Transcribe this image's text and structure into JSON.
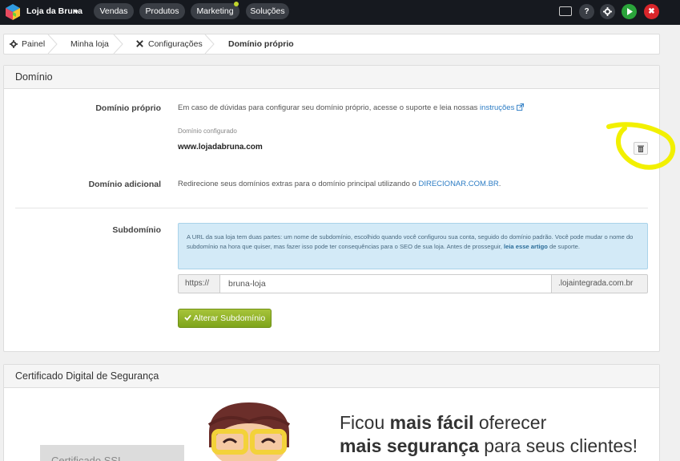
{
  "topbar": {
    "store_name": "Loja da Bruna",
    "nav": [
      "Vendas",
      "Produtos",
      "Marketing",
      "Soluções"
    ],
    "icons": [
      "monitor-icon",
      "help-icon",
      "gear-icon",
      "play-icon",
      "close-icon"
    ],
    "colors": {
      "bar": "#16191f",
      "play": "#2aa33a",
      "close": "#d9252a",
      "notification": "#c2d62d"
    }
  },
  "breadcrumb": [
    "Painel",
    "Minha loja",
    "Configurações",
    "Domínio próprio"
  ],
  "domain_panel": {
    "title": "Domínio",
    "own_domain": {
      "label": "Domínio próprio",
      "help_text": "Em caso de dúvidas para configurar seu domínio próprio, acesse o suporte e leia nossas",
      "help_link": "instruções",
      "configured_label": "Domínio configurado",
      "configured_value": "www.lojadabruna.com"
    },
    "additional_domain": {
      "label": "Domínio adicional",
      "text": "Redirecione seus domínios extras para o domínio principal utilizando o",
      "link": "DIRECIONAR.COM.BR",
      "after": "."
    },
    "subdomain": {
      "label": "Subdomínio",
      "info_line1": "A URL da sua loja tem duas partes: um nome de subdomínio, escolhido quando você configurou sua conta, seguido do domínio padrão. Você pode",
      "info_line2": "mudar o nome do subdomínio na hora que quiser, mas fazer isso pode ter consequências para o SEO de sua loja. Antes de prosseguir,",
      "info_link": "leia esse artigo",
      "info_line3": "de suporte.",
      "prefix": "https://",
      "value": "bruna-loja",
      "suffix": ".lojaintegrada.com.br",
      "button": "Alterar Subdomínio"
    }
  },
  "ssl_panel": {
    "title": "Certificado Digital de Segurança",
    "tag": "Certificado SSL",
    "promo_line1_a": "Ficou",
    "promo_line1_b": "mais fácil",
    "promo_line1_c": "oferecer",
    "promo_line2_a": "mais segurança",
    "promo_line2_b": "para seus clientes!"
  }
}
